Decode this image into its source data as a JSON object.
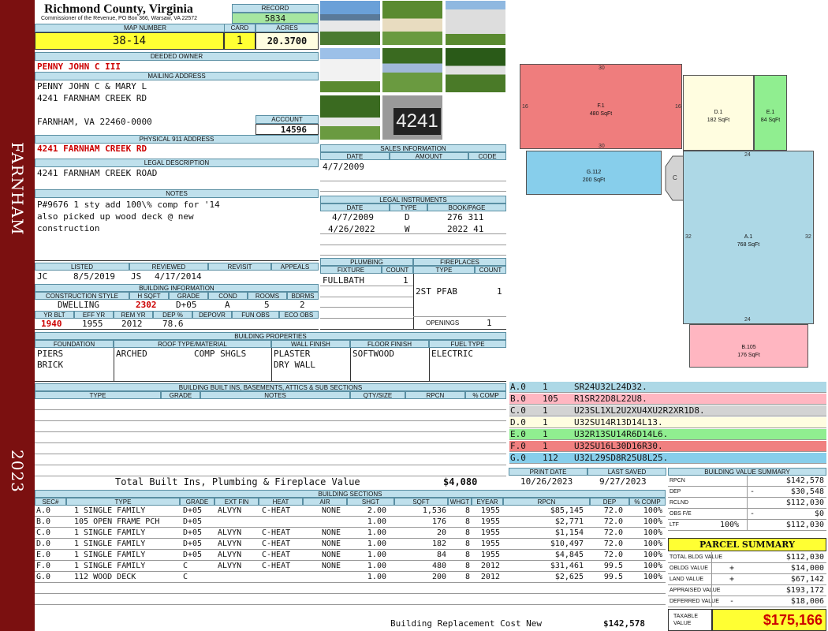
{
  "header": {
    "county": "Richmond County, Virginia",
    "commissioner": "Commissioner of the Revenue, PO Box 366, Warsaw, VA 22572"
  },
  "record": {
    "label": "RECORD",
    "value": "5834"
  },
  "map": {
    "label": "MAP NUMBER",
    "value": "38-14"
  },
  "card": {
    "label": "CARD",
    "value": "1"
  },
  "acres": {
    "label": "ACRES",
    "value": "20.3700"
  },
  "deeded_owner": {
    "label": "DEEDED OWNER",
    "value": "PENNY JOHN C III"
  },
  "mailing": {
    "label": "MAILING ADDRESS",
    "line1": "PENNY JOHN C & MARY L",
    "line2": "4241 FARNHAM CREEK RD",
    "line3": "FARNHAM, VA 22460-0000"
  },
  "account": {
    "label": "ACCOUNT",
    "value": "14596"
  },
  "physical": {
    "label": "PHYSICAL 911 ADDRESS",
    "value": "4241 FARNHAM CREEK RD"
  },
  "legal": {
    "label": "LEGAL DESCRIPTION",
    "value": "4241 FARNHAM CREEK ROAD"
  },
  "notes": {
    "label": "NOTES",
    "line1": "P#9676 1 sty add 100\\% comp for '14",
    "line2": "also picked up wood deck @ new",
    "line3": "construction"
  },
  "side": {
    "district": "FARNHAM",
    "year": "2023"
  },
  "photo_caption": "4241",
  "sales": {
    "label": "SALES INFORMATION",
    "cols": [
      "DATE",
      "AMOUNT",
      "CODE"
    ],
    "rows": [
      {
        "date": "4/7/2009"
      }
    ]
  },
  "legal_inst": {
    "label": "LEGAL INSTRUMENTS",
    "cols": [
      "DATE",
      "TYPE",
      "BOOK/PAGE"
    ],
    "rows": [
      {
        "date": "4/7/2009",
        "type": "D",
        "book": "276 311"
      },
      {
        "date": "4/26/2022",
        "type": "W",
        "book": "2022 41"
      }
    ]
  },
  "review": {
    "cols": [
      "LISTED",
      "REVIEWED",
      "REVISIT",
      "APPEALS"
    ],
    "listed_by": "JC",
    "listed_date": "8/5/2019",
    "reviewed_by": "JS",
    "reviewed_date": "4/17/2014"
  },
  "building_info": {
    "label": "BUILDING INFORMATION",
    "cols": [
      "CONSTRUCTION STYLE",
      "H SQFT",
      "GRADE",
      "COND",
      "ROOMS",
      "BDRMS"
    ],
    "style": "DWELLING",
    "hsqft": "2302",
    "grade": "D+05",
    "cond": "A",
    "rooms": "5",
    "bdrms": "2",
    "cols2": [
      "YR BLT",
      "EFF YR",
      "REM YR",
      "DEP %",
      "DEPOVR",
      "FUN OBS",
      "ECO OBS"
    ],
    "yrblt": "1940",
    "effyr": "1955",
    "remyr": "2012",
    "dep": "78.6"
  },
  "plumbing": {
    "label": "PLUMBING",
    "cols": [
      "FIXTURE",
      "COUNT"
    ],
    "fixture": "FULLBATH",
    "count": "1"
  },
  "fireplaces": {
    "label": "FIREPLACES",
    "cols": [
      "TYPE",
      "COUNT"
    ],
    "type": "2ST PFAB",
    "count": "1",
    "openings_label": "OPENINGS",
    "openings": "1"
  },
  "properties": {
    "label": "BUILDING PROPERTIES",
    "cols": [
      "FOUNDATION",
      "ROOF TYPE/MATERIAL",
      "WALL FINISH",
      "FLOOR FINISH",
      "FUEL TYPE"
    ],
    "foundation1": "PIERS",
    "foundation2": "BRICK",
    "roof_type": "ARCHED",
    "roof_mat": "COMP SHGLS",
    "wall1": "PLASTER",
    "wall2": "DRY WALL",
    "floor": "SOFTWOOD",
    "fuel": "ELECTRIC"
  },
  "builtins": {
    "label": "BUILDING BUILT INS, BASEMENTS, ATTICS & SUB SECTIONS",
    "cols": [
      "TYPE",
      "GRADE",
      "NOTES",
      "QTY/SIZE",
      "RPCN",
      "% COMP"
    ],
    "total_label": "Total Built Ins, Plumbing & Fireplace Value",
    "total": "$4,080"
  },
  "print": {
    "print_label": "PRINT DATE",
    "print_date": "10/26/2023",
    "saved_label": "LAST SAVED",
    "saved_date": "9/27/2023"
  },
  "sketch": {
    "f1": {
      "name": "F.1",
      "area": "480 SqFt",
      "top": "30",
      "bottom": "30",
      "left": "16",
      "right": "16"
    },
    "d1": {
      "name": "D.1",
      "area": "182 SqFt"
    },
    "e1": {
      "name": "E.1",
      "area": "84 SqFt"
    },
    "g112": {
      "name": "G.112",
      "area": "200 SqFt"
    },
    "c": {
      "name": "C"
    },
    "a1": {
      "name": "A.1",
      "area": "768 SqFt",
      "top": "24",
      "bottom": "24",
      "left": "32",
      "right": "32"
    },
    "b105": {
      "name": "B.105",
      "area": "176 SqFt"
    }
  },
  "sections_codes": [
    {
      "sec": "A.0",
      "n": "1",
      "code": "SR24U32L24D32.",
      "color": "#add8e6"
    },
    {
      "sec": "B.0",
      "n": "105",
      "code": "R1SR22D8L22U8.",
      "color": "#ffb6c1"
    },
    {
      "sec": "C.0",
      "n": "1",
      "code": "U23SL1XL2U2XU4XU2R2XR1D8.",
      "color": "#d3d3d3"
    },
    {
      "sec": "D.0",
      "n": "1",
      "code": "U32SU14R13D14L13.",
      "color": "#fffde0"
    },
    {
      "sec": "E.0",
      "n": "1",
      "code": "U32R13SU14R6D14L6.",
      "color": "#90ee90"
    },
    {
      "sec": "F.0",
      "n": "1",
      "code": "U32SU16L30D16R30.",
      "color": "#f08080"
    },
    {
      "sec": "G.0",
      "n": "112",
      "code": "U32L29SD8R25U8L25.",
      "color": "#87ceeb"
    }
  ],
  "bsections": {
    "label": "BUILDING SECTIONS",
    "cols": [
      "SEC#",
      "TYPE",
      "GRADE",
      "EXT FIN",
      "HEAT",
      "AIR",
      "SHGT",
      "SQFT",
      "WHGT",
      "EYEAR",
      "RPCN",
      "DEP",
      "% COMP"
    ],
    "rows": [
      {
        "sec": "A.0",
        "type": "1 SINGLE FAMILY",
        "grade": "D+05",
        "ext": "ALVYN",
        "heat": "C-HEAT",
        "air": "NONE",
        "shgt": "2.00",
        "sqft": "1,536",
        "whgt": "8",
        "eyear": "1955",
        "rpcn": "$85,145",
        "dep": "72.0",
        "comp": "100%"
      },
      {
        "sec": "B.0",
        "type": "105 OPEN FRAME PCH",
        "grade": "D+05",
        "ext": "",
        "heat": "",
        "air": "",
        "shgt": "1.00",
        "sqft": "176",
        "whgt": "8",
        "eyear": "1955",
        "rpcn": "$2,771",
        "dep": "72.0",
        "comp": "100%"
      },
      {
        "sec": "C.0",
        "type": "1 SINGLE FAMILY",
        "grade": "D+05",
        "ext": "ALVYN",
        "heat": "C-HEAT",
        "air": "NONE",
        "shgt": "1.00",
        "sqft": "20",
        "whgt": "8",
        "eyear": "1955",
        "rpcn": "$1,154",
        "dep": "72.0",
        "comp": "100%"
      },
      {
        "sec": "D.0",
        "type": "1 SINGLE FAMILY",
        "grade": "D+05",
        "ext": "ALVYN",
        "heat": "C-HEAT",
        "air": "NONE",
        "shgt": "1.00",
        "sqft": "182",
        "whgt": "8",
        "eyear": "1955",
        "rpcn": "$10,497",
        "dep": "72.0",
        "comp": "100%"
      },
      {
        "sec": "E.0",
        "type": "1 SINGLE FAMILY",
        "grade": "D+05",
        "ext": "ALVYN",
        "heat": "C-HEAT",
        "air": "NONE",
        "shgt": "1.00",
        "sqft": "84",
        "whgt": "8",
        "eyear": "1955",
        "rpcn": "$4,845",
        "dep": "72.0",
        "comp": "100%"
      },
      {
        "sec": "F.0",
        "type": "1 SINGLE FAMILY",
        "grade": "C",
        "ext": "ALVYN",
        "heat": "C-HEAT",
        "air": "NONE",
        "shgt": "1.00",
        "sqft": "480",
        "whgt": "8",
        "eyear": "2012",
        "rpcn": "$31,461",
        "dep": "99.5",
        "comp": "100%"
      },
      {
        "sec": "G.0",
        "type": "112 WOOD DECK",
        "grade": "C",
        "ext": "",
        "heat": "",
        "air": "",
        "shgt": "1.00",
        "sqft": "200",
        "whgt": "8",
        "eyear": "2012",
        "rpcn": "$2,625",
        "dep": "99.5",
        "comp": "100%"
      }
    ],
    "total_label": "Building Replacement Cost New",
    "total": "$142,578"
  },
  "bvs": {
    "label": "BUILDING VALUE SUMMARY",
    "rpcn_l": "RPCN",
    "rpcn": "$142,578",
    "dep_l": "DEP",
    "dep_sign": "-",
    "dep": "$30,548",
    "rclnd_l": "RCLND",
    "rclnd": "$112,030",
    "obs_l": "OBS F/E",
    "obs_sign": "-",
    "obs": "$0",
    "ltf_l": "LTF",
    "ltf_pct": "100%",
    "ltf": "$112,030"
  },
  "parcel": {
    "label": "PARCEL SUMMARY",
    "tbv_l": "TOTAL BLDG VALUE",
    "tbv": "$112,030",
    "obldg_l": "OBLDG VALUE",
    "obldg_sign": "+",
    "obldg": "$14,000",
    "land_l": "LAND VALUE",
    "land_sign": "+",
    "land": "$67,142",
    "appr_l": "APPRAISED VALUE",
    "appr": "$193,172",
    "def_l": "DEFERRED VALUE",
    "def_sign": "-",
    "def": "$18,006",
    "tax_l1": "TAXABLE",
    "tax_l2": "VALUE",
    "tax": "$175,166"
  }
}
